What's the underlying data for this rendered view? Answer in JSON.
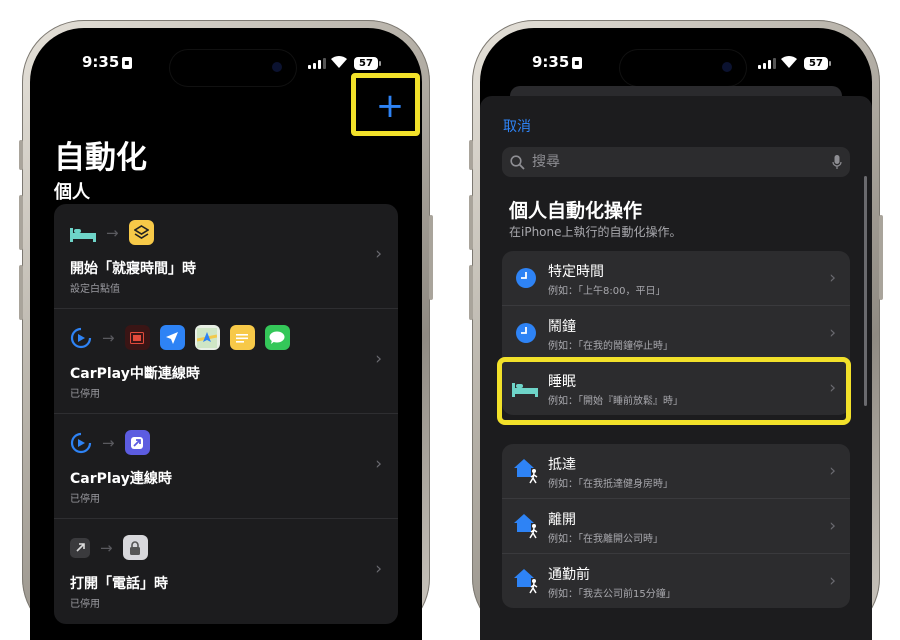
{
  "status": {
    "time": "9:35",
    "battery": "57"
  },
  "left": {
    "title": "自動化",
    "section": "個人",
    "add_label": "+",
    "automations": [
      {
        "title": "開始「就寢時間」時",
        "subtitle": "設定白點值"
      },
      {
        "title": "CarPlay中斷連線時",
        "subtitle": "已停用"
      },
      {
        "title": "CarPlay連線時",
        "subtitle": "已停用"
      },
      {
        "title": "打開「電話」時",
        "subtitle": "已停用"
      }
    ]
  },
  "right": {
    "cancel": "取消",
    "search_placeholder": "搜尋",
    "title": "個人自動化操作",
    "subtitle": "在iPhone上執行的自動化操作。",
    "triggers_time": [
      {
        "title": "特定時間",
        "subtitle": "例如：「上午8:00，平日」"
      },
      {
        "title": "鬧鐘",
        "subtitle": "例如：「在我的鬧鐘停止時」"
      },
      {
        "title": "睡眠",
        "subtitle": "例如：「開始『睡前放鬆』時」"
      }
    ],
    "triggers_location": [
      {
        "title": "抵達",
        "subtitle": "例如：「在我抵達健身房時」"
      },
      {
        "title": "離開",
        "subtitle": "例如：「在我離開公司時」"
      },
      {
        "title": "通勤前",
        "subtitle": "例如：「我去公司前15分鐘」"
      }
    ]
  },
  "colors": {
    "accent": "#2e83f5",
    "highlight": "#f2e12a",
    "card": "#1c1c1e",
    "sleep": "#6ed4c8"
  }
}
